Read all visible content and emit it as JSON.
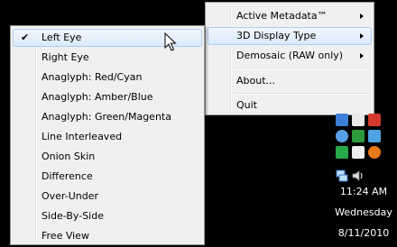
{
  "parent_menu": {
    "items": [
      {
        "label": "Active Metadata™",
        "submenu": true
      },
      {
        "label": "3D Display Type",
        "submenu": true,
        "highlighted": true
      },
      {
        "label": "Demosaic (RAW only)",
        "submenu": true
      },
      {
        "label": "About...",
        "submenu": false
      },
      {
        "label": "Quit",
        "submenu": false
      }
    ]
  },
  "submenu": {
    "check_glyph": "✔",
    "items": [
      {
        "label": "Left Eye",
        "checked": true,
        "highlighted": true
      },
      {
        "label": "Right Eye"
      },
      {
        "label": "Anaglyph: Red/Cyan"
      },
      {
        "label": "Anaglyph: Amber/Blue"
      },
      {
        "label": "Anaglyph: Green/Magenta"
      },
      {
        "label": "Line Interleaved"
      },
      {
        "label": "Onion Skin"
      },
      {
        "label": "Difference"
      },
      {
        "label": "Over-Under"
      },
      {
        "label": "Side-By-Side"
      },
      {
        "label": "Free View"
      }
    ]
  },
  "taskbar": {
    "time": "11:24 AM",
    "day": "Wednesday",
    "date": "8/11/2010"
  },
  "tray_icons": [
    "network-icon",
    "volume-icon",
    "app-icon",
    "app-icon",
    "app-icon",
    "app-icon",
    "app-icon",
    "app-icon",
    "app-icon"
  ],
  "colors": {
    "menu_bg": "#f0f0f0",
    "highlight": "#d9e9fb",
    "highlight_border": "#aecff7",
    "desktop": "#000000"
  }
}
